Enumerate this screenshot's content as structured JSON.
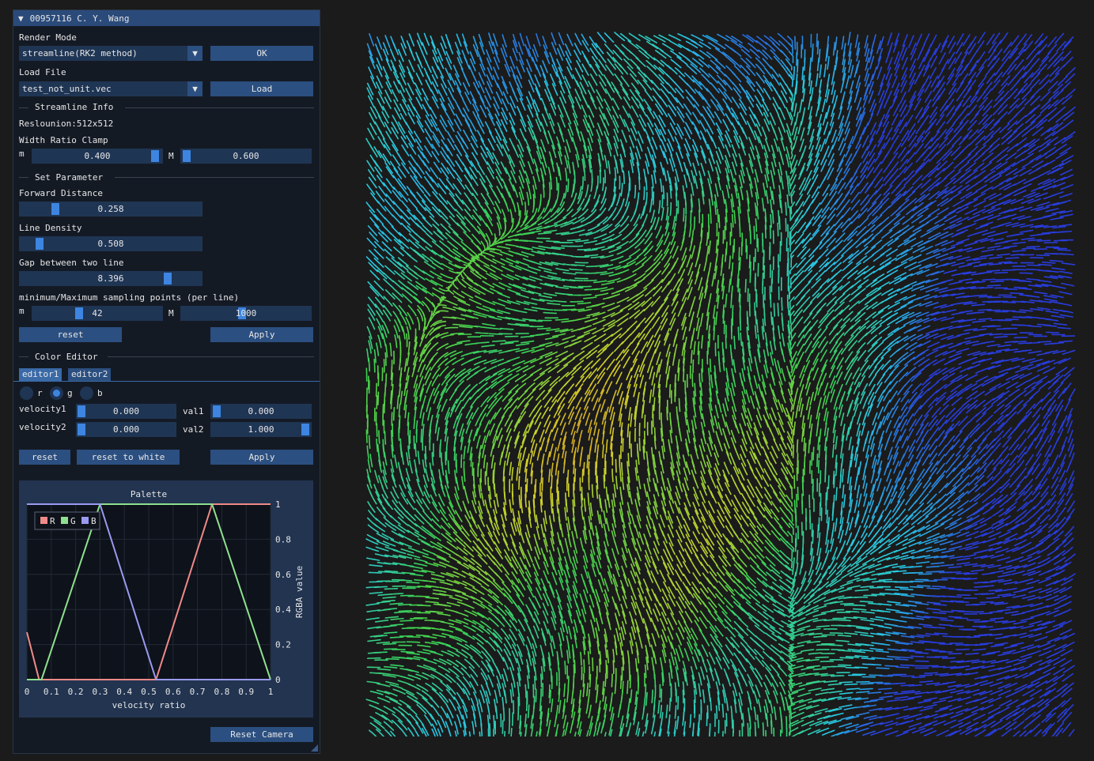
{
  "window": {
    "title": "00957116 C. Y. Wang"
  },
  "render_mode": {
    "label": "Render Mode",
    "value": "streamline(RK2 method)",
    "ok_label": "OK"
  },
  "load_file": {
    "label": "Load File",
    "value": "test_not_unit.vec",
    "load_label": "Load"
  },
  "streamline_info": {
    "header": "Streamline Info",
    "resolution": "Reslounion:512x512",
    "width_clamp_label": "Width Ratio Clamp",
    "m_label": "m",
    "M_label": "M",
    "m_value": "0.400",
    "M_value": "0.600"
  },
  "set_parameter": {
    "header": "Set Parameter",
    "forward_label": "Forward Distance",
    "forward_value": "0.258",
    "density_label": "Line Density",
    "density_value": "0.508",
    "gap_label": "Gap between two line",
    "gap_value": "8.396",
    "sampling_label": "minimum/Maximum sampling points (per line)",
    "m_label": "m",
    "M_label": "M",
    "min_value": "42",
    "max_value": "1000",
    "reset_label": "reset",
    "apply_label": "Apply"
  },
  "color_editor": {
    "header": "Color Editor",
    "tabs": [
      "editor1",
      "editor2"
    ],
    "radios": [
      "r",
      "g",
      "b"
    ],
    "velocity1_label": "velocity1",
    "velocity1_value": "0.000",
    "val1_label": "val1",
    "val1_value": "0.000",
    "velocity2_label": "velocity2",
    "velocity2_value": "0.000",
    "val2_label": "val2",
    "val2_value": "1.000",
    "reset_label": "reset",
    "reset_white_label": "reset to white",
    "apply_label": "Apply"
  },
  "reset_camera_label": "Reset Camera",
  "colors": {
    "R": "#f08a8a",
    "G": "#8ee08e",
    "B": "#9a9af0",
    "accent": "#3d85e0"
  },
  "chart_data": {
    "type": "line",
    "title": "Palette",
    "xlabel": "velocity ratio",
    "ylabel": "RGBA value",
    "xlim": [
      0,
      1
    ],
    "ylim": [
      0,
      1
    ],
    "xticks": [
      "0",
      "0.1",
      "0.2",
      "0.3",
      "0.4",
      "0.5",
      "0.6",
      "0.7",
      "0.8",
      "0.9",
      "1"
    ],
    "yticks": [
      "0",
      "0.2",
      "0.4",
      "0.6",
      "0.8",
      "1"
    ],
    "legend": "top-left",
    "series": [
      {
        "name": "R",
        "x": [
          0,
          0.05,
          0.53,
          0.76,
          1
        ],
        "y": [
          0.27,
          0,
          0,
          1,
          1
        ]
      },
      {
        "name": "G",
        "x": [
          0,
          0.06,
          0.3,
          0.76,
          1
        ],
        "y": [
          0,
          0,
          1,
          1,
          0
        ]
      },
      {
        "name": "B",
        "x": [
          0,
          0.3,
          0.53,
          1
        ],
        "y": [
          1,
          1,
          0,
          0
        ]
      }
    ]
  }
}
